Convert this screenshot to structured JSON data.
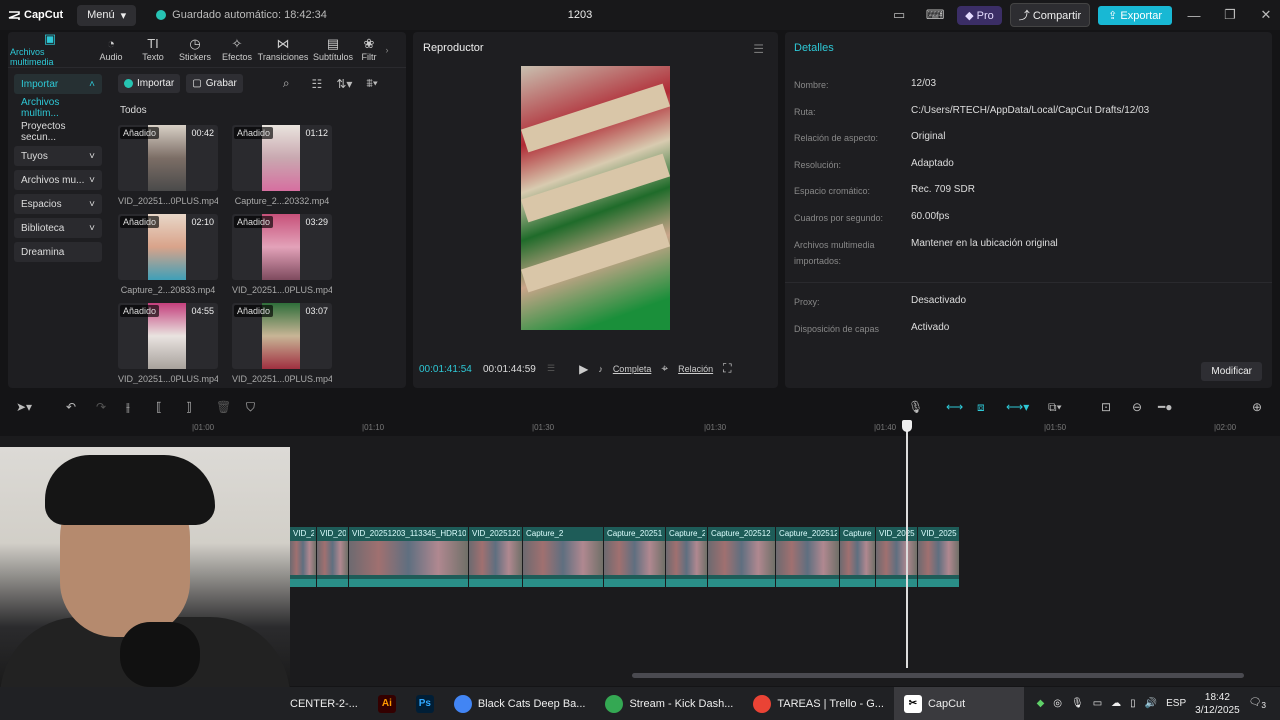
{
  "app": {
    "name": "CapCut",
    "menu_label": "Menú",
    "autosave": "Guardado automático: 18:42:34",
    "project_title": "1203",
    "pro_label": "Pro",
    "share_label": "Compartir",
    "export_label": "Exportar",
    "accent": "#2ec8d6"
  },
  "tool_tabs": [
    {
      "label": "Archivos multimedia",
      "icon": "media-icon"
    },
    {
      "label": "Audio",
      "icon": "audio-icon"
    },
    {
      "label": "Texto",
      "icon": "text-icon"
    },
    {
      "label": "Stickers",
      "icon": "sticker-icon"
    },
    {
      "label": "Efectos",
      "icon": "effects-icon"
    },
    {
      "label": "Transiciones",
      "icon": "transitions-icon"
    },
    {
      "label": "Subtítulos",
      "icon": "subtitles-icon"
    },
    {
      "label": "Filtr",
      "icon": "filters-icon"
    }
  ],
  "side_nav": [
    {
      "label": "Importar"
    },
    {
      "label": "Archivos multim..."
    },
    {
      "label": "Proyectos secun..."
    },
    {
      "label": "Tuyos"
    },
    {
      "label": "Archivos mu..."
    },
    {
      "label": "Espacios"
    },
    {
      "label": "Biblioteca"
    },
    {
      "label": "Dreamina"
    }
  ],
  "media": {
    "import_btn": "Importar",
    "record_btn": "Grabar",
    "filter_label": "Todos",
    "items": [
      {
        "badge": "Añadido",
        "duration": "00:42",
        "name": "VID_20251...0PLUS.mp4"
      },
      {
        "badge": "Añadido",
        "duration": "01:12",
        "name": "Capture_2...20332.mp4"
      },
      {
        "badge": "Añadido",
        "duration": "02:10",
        "name": "Capture_2...20833.mp4"
      },
      {
        "badge": "Añadido",
        "duration": "03:29",
        "name": "VID_20251...0PLUS.mp4"
      },
      {
        "badge": "Añadido",
        "duration": "04:55",
        "name": "VID_20251...0PLUS.mp4"
      },
      {
        "badge": "Añadido",
        "duration": "03:07",
        "name": "VID_20251...0PLUS.mp4"
      }
    ]
  },
  "player": {
    "title": "Reproductor",
    "current_time": "00:01:41:54",
    "total_time": "00:01:44:59",
    "full_label": "Completa",
    "ratio_label": "Relación"
  },
  "details": {
    "title": "Detalles",
    "rows": [
      {
        "label": "Nombre:",
        "value": "12/03"
      },
      {
        "label": "Ruta:",
        "value": "C:/Users/RTECH/AppData/Local/CapCut Drafts/12/03"
      },
      {
        "label": "Relación de aspecto:",
        "value": "Original"
      },
      {
        "label": "Resolución:",
        "value": "Adaptado"
      },
      {
        "label": "Espacio cromático:",
        "value": "Rec. 709 SDR"
      },
      {
        "label": "Cuadros por segundo:",
        "value": "60.00fps"
      },
      {
        "label": "Archivos multimedia importados:",
        "value": "Mantener en la ubicación original"
      },
      {
        "label": "Proxy:",
        "value": "Desactivado"
      },
      {
        "label": "Disposición de capas",
        "value": "Activado"
      }
    ],
    "modify_label": "Modificar"
  },
  "ruler": [
    "|01:00",
    "|01:10",
    "|01:30",
    "|01:30",
    "|01:40",
    "|01:50",
    "|02:00"
  ],
  "clips": [
    {
      "label": "VID_202"
    },
    {
      "label": "VID_20"
    },
    {
      "label": "VID_20251203_113345_HDR10PLUS"
    },
    {
      "label": "VID_2025120"
    },
    {
      "label": "Capture_2"
    },
    {
      "label": "Capture_20251"
    },
    {
      "label": "Capture_2"
    },
    {
      "label": "Capture_202512"
    },
    {
      "label": "Capture_202512"
    },
    {
      "label": "Capture"
    },
    {
      "label": "VID_2025"
    },
    {
      "label": "VID_2025"
    }
  ],
  "taskbar": {
    "apps": [
      {
        "label": "CENTER-2-...",
        "icon": ""
      },
      {
        "label": "",
        "icon": "Ai"
      },
      {
        "label": "",
        "icon": "Ps"
      },
      {
        "label": "Black Cats Deep Ba...",
        "icon": ""
      },
      {
        "label": "Stream - Kick Dash...",
        "icon": ""
      },
      {
        "label": "TAREAS | Trello - G...",
        "icon": ""
      },
      {
        "label": "CapCut",
        "icon": ""
      }
    ],
    "language": "ESP",
    "time": "18:42",
    "date": "3/12/2025",
    "notifications": "3"
  }
}
